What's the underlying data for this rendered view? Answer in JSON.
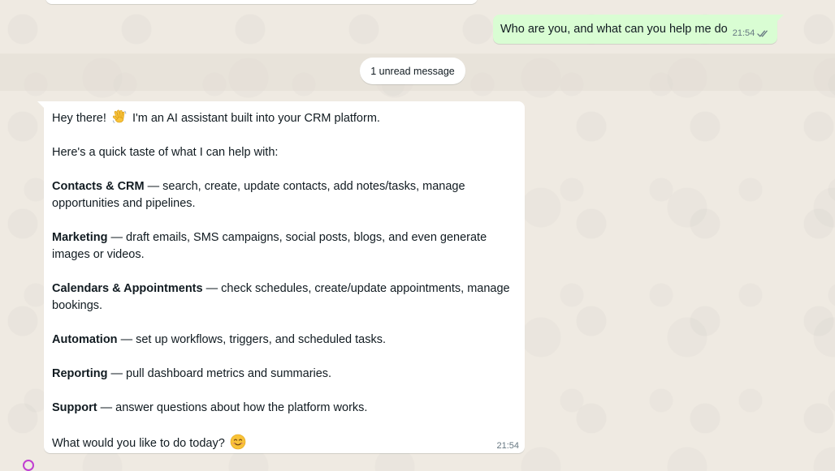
{
  "chat": {
    "outgoing": {
      "text": "Who are you, and what can you help me do",
      "time": "21:54",
      "status_icon": "double-check-icon"
    },
    "unread_label": "1 unread message",
    "incoming": {
      "greeting_before": "Hey there!",
      "greeting_after": "I'm an AI assistant built into your CRM platform.",
      "intro": "Here's a quick taste of what I can help with:",
      "sections": [
        {
          "title": "Contacts & CRM",
          "desc": " — search, create, update contacts, add notes/tasks, manage opportunities and pipelines."
        },
        {
          "title": "Marketing",
          "desc": " — draft emails, SMS campaigns, social posts, blogs, and even generate images or videos."
        },
        {
          "title": "Calendars & Appointments",
          "desc": " — check schedules, create/update appointments, manage bookings."
        },
        {
          "title": "Automation",
          "desc": " — set up workflows, triggers, and scheduled tasks."
        },
        {
          "title": "Reporting",
          "desc": " — pull dashboard metrics and summaries."
        },
        {
          "title": "Support",
          "desc": " — answer questions about how the platform works."
        }
      ],
      "closing": "What would you like to do today?",
      "time": "21:54",
      "emojis": [
        "waving-hand-icon",
        "smiling-face-icon"
      ]
    }
  },
  "colors": {
    "wallpaper": "#efeae2",
    "outgoing_bubble": "#d9fdd3",
    "incoming_bubble": "#ffffff",
    "meta_text": "#667781",
    "cursor": "#c03fd1"
  }
}
